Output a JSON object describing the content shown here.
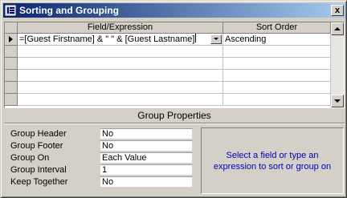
{
  "window": {
    "title": "Sorting and Grouping",
    "close_glyph": "x"
  },
  "grid": {
    "headers": {
      "field": "Field/Expression",
      "sort": "Sort Order"
    },
    "rows": [
      {
        "field": "=[Guest Firstname] & \" \" & [Guest Lastname]",
        "sort": "Ascending"
      },
      {
        "field": "",
        "sort": ""
      },
      {
        "field": "",
        "sort": ""
      },
      {
        "field": "",
        "sort": ""
      },
      {
        "field": "",
        "sort": ""
      },
      {
        "field": "",
        "sort": ""
      }
    ],
    "current_row_indicator": "row-pointer-icon"
  },
  "group_properties": {
    "title": "Group Properties",
    "items": [
      {
        "label": "Group Header",
        "value": "No"
      },
      {
        "label": "Group Footer",
        "value": "No"
      },
      {
        "label": "Group On",
        "value": "Each Value"
      },
      {
        "label": "Group Interval",
        "value": "1"
      },
      {
        "label": "Keep Together",
        "value": "No"
      }
    ],
    "hint": "Select a field or type an expression to sort or group on"
  },
  "colors": {
    "titlebar_start": "#0a246a",
    "titlebar_end": "#a6caf0",
    "hint_text": "#0000c0",
    "face": "#d4d0c8"
  }
}
